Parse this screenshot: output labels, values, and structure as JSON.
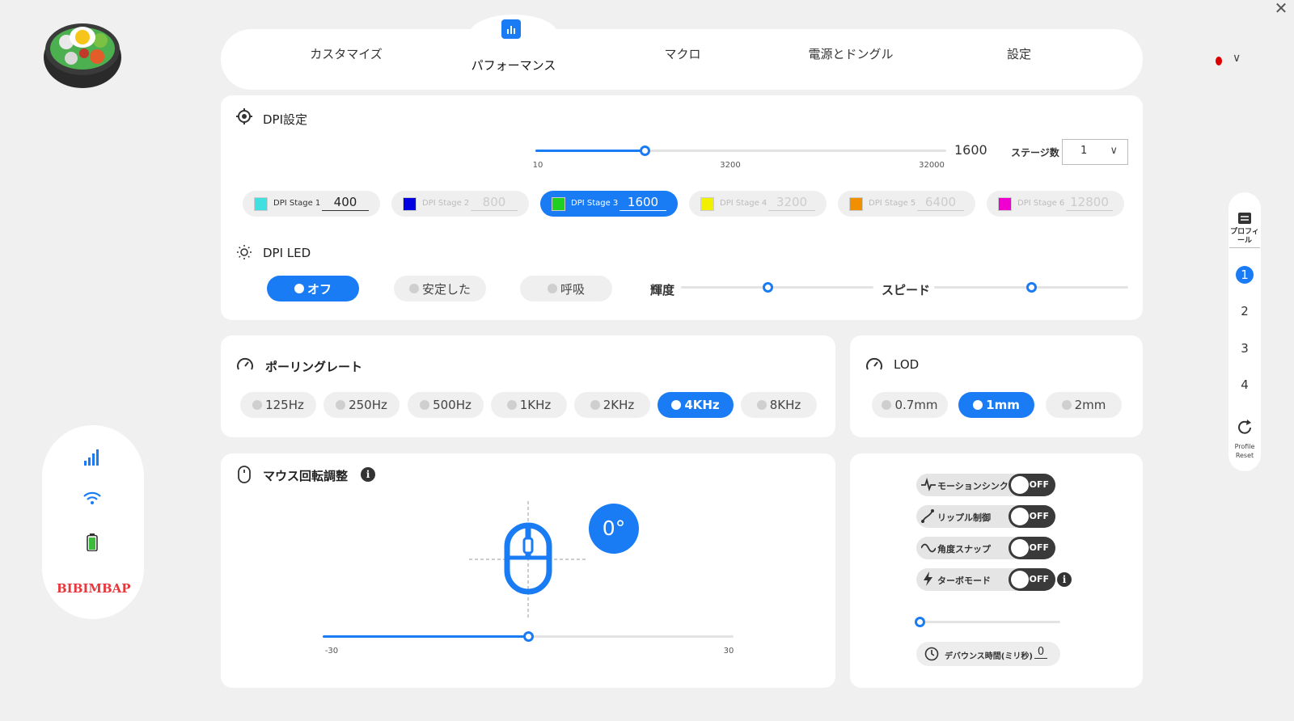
{
  "window": {
    "close_glyph": "✕"
  },
  "brand": {
    "name": "BIBIMBAP"
  },
  "nav": {
    "tabs": [
      {
        "label": "カスタマイズ"
      },
      {
        "label": "パフォーマンス",
        "active": true
      },
      {
        "label": "マクロ"
      },
      {
        "label": "電源とドングル"
      },
      {
        "label": "設定"
      }
    ]
  },
  "language": {
    "chevron": "∨"
  },
  "dpi": {
    "title": "DPI設定",
    "current_value": "1600",
    "slider": {
      "min_label": "10",
      "mid_label": "3200",
      "max_label": "32000",
      "value": 1600,
      "fraction": 0.265
    },
    "stage_count_label": "ステージ数",
    "stage_count_value": "1",
    "stage_count_chevron": "∨",
    "stages": [
      {
        "label": "DPI Stage 1",
        "value": "400",
        "color": "#40e0e0"
      },
      {
        "label": "DPI Stage 2",
        "value": "800",
        "color": "#0000e0"
      },
      {
        "label": "DPI Stage 3",
        "value": "1600",
        "color": "#20d020",
        "active": true
      },
      {
        "label": "DPI Stage 4",
        "value": "3200",
        "color": "#f0f000"
      },
      {
        "label": "DPI Stage 5",
        "value": "6400",
        "color": "#f09000"
      },
      {
        "label": "DPI Stage 6",
        "value": "12800",
        "color": "#f000d0"
      }
    ]
  },
  "dpi_led": {
    "title": "DPI LED",
    "modes": [
      {
        "label": "オフ",
        "active": true
      },
      {
        "label": "安定した"
      },
      {
        "label": "呼吸"
      }
    ],
    "brightness_label": "輝度",
    "brightness_fraction": 0.45,
    "speed_label": "スピード",
    "speed_fraction": 0.5
  },
  "polling": {
    "title": "ポーリングレート",
    "options": [
      {
        "label": "125Hz"
      },
      {
        "label": "250Hz"
      },
      {
        "label": "500Hz"
      },
      {
        "label": "1KHz"
      },
      {
        "label": "2KHz"
      },
      {
        "label": "4KHz",
        "active": true
      },
      {
        "label": "8KHz"
      }
    ]
  },
  "lod": {
    "title": "LOD",
    "options": [
      {
        "label": "0.7mm"
      },
      {
        "label": "1mm",
        "active": true
      },
      {
        "label": "2mm"
      }
    ]
  },
  "rotation": {
    "title": "マウス回転調整",
    "info": "i",
    "angle_display": "0°",
    "slider": {
      "min_label": "-30",
      "max_label": "30",
      "value": 0,
      "fraction": 0.5
    }
  },
  "options": {
    "toggles": [
      {
        "label": "モーションシンク",
        "state": "OFF"
      },
      {
        "label": "リップル制御",
        "state": "OFF"
      },
      {
        "label": "角度スナップ",
        "state": "OFF"
      },
      {
        "label": "ターボモード",
        "state": "OFF"
      }
    ],
    "info": "i",
    "slider_fraction": 0.0,
    "debounce_label": "デバウンス時間(ミリ秒)",
    "debounce_value": "0"
  },
  "profile": {
    "label": "プロフィール",
    "numbers": [
      "1",
      "2",
      "3",
      "4"
    ],
    "active_index": 0,
    "reset_label_1": "Profile",
    "reset_label_2": "Reset"
  },
  "colors": {
    "accent": "#1a7cf5",
    "brand": "#e8383d"
  }
}
